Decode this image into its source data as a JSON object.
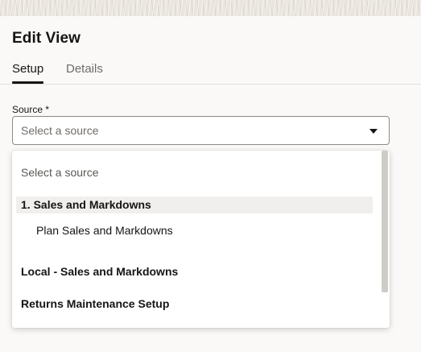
{
  "dialog": {
    "title": "Edit View"
  },
  "tabs": [
    {
      "label": "Setup",
      "active": true
    },
    {
      "label": "Details",
      "active": false
    }
  ],
  "source_field": {
    "label": "Source *",
    "placeholder": "Select a source"
  },
  "dropdown": {
    "placeholder_option": "Select a source",
    "options": [
      {
        "label": "1. Sales and Markdowns",
        "type": "group",
        "highlighted": true
      },
      {
        "label": "Plan Sales and Markdowns",
        "type": "item"
      },
      {
        "label": "Local - Sales and Markdowns",
        "type": "group"
      },
      {
        "label": "Returns Maintenance Setup",
        "type": "group"
      }
    ]
  },
  "colors": {
    "panel_background": "#faf9f8",
    "text_primary": "#161513",
    "text_secondary": "#6f6c68",
    "highlight": "#f1efed"
  }
}
